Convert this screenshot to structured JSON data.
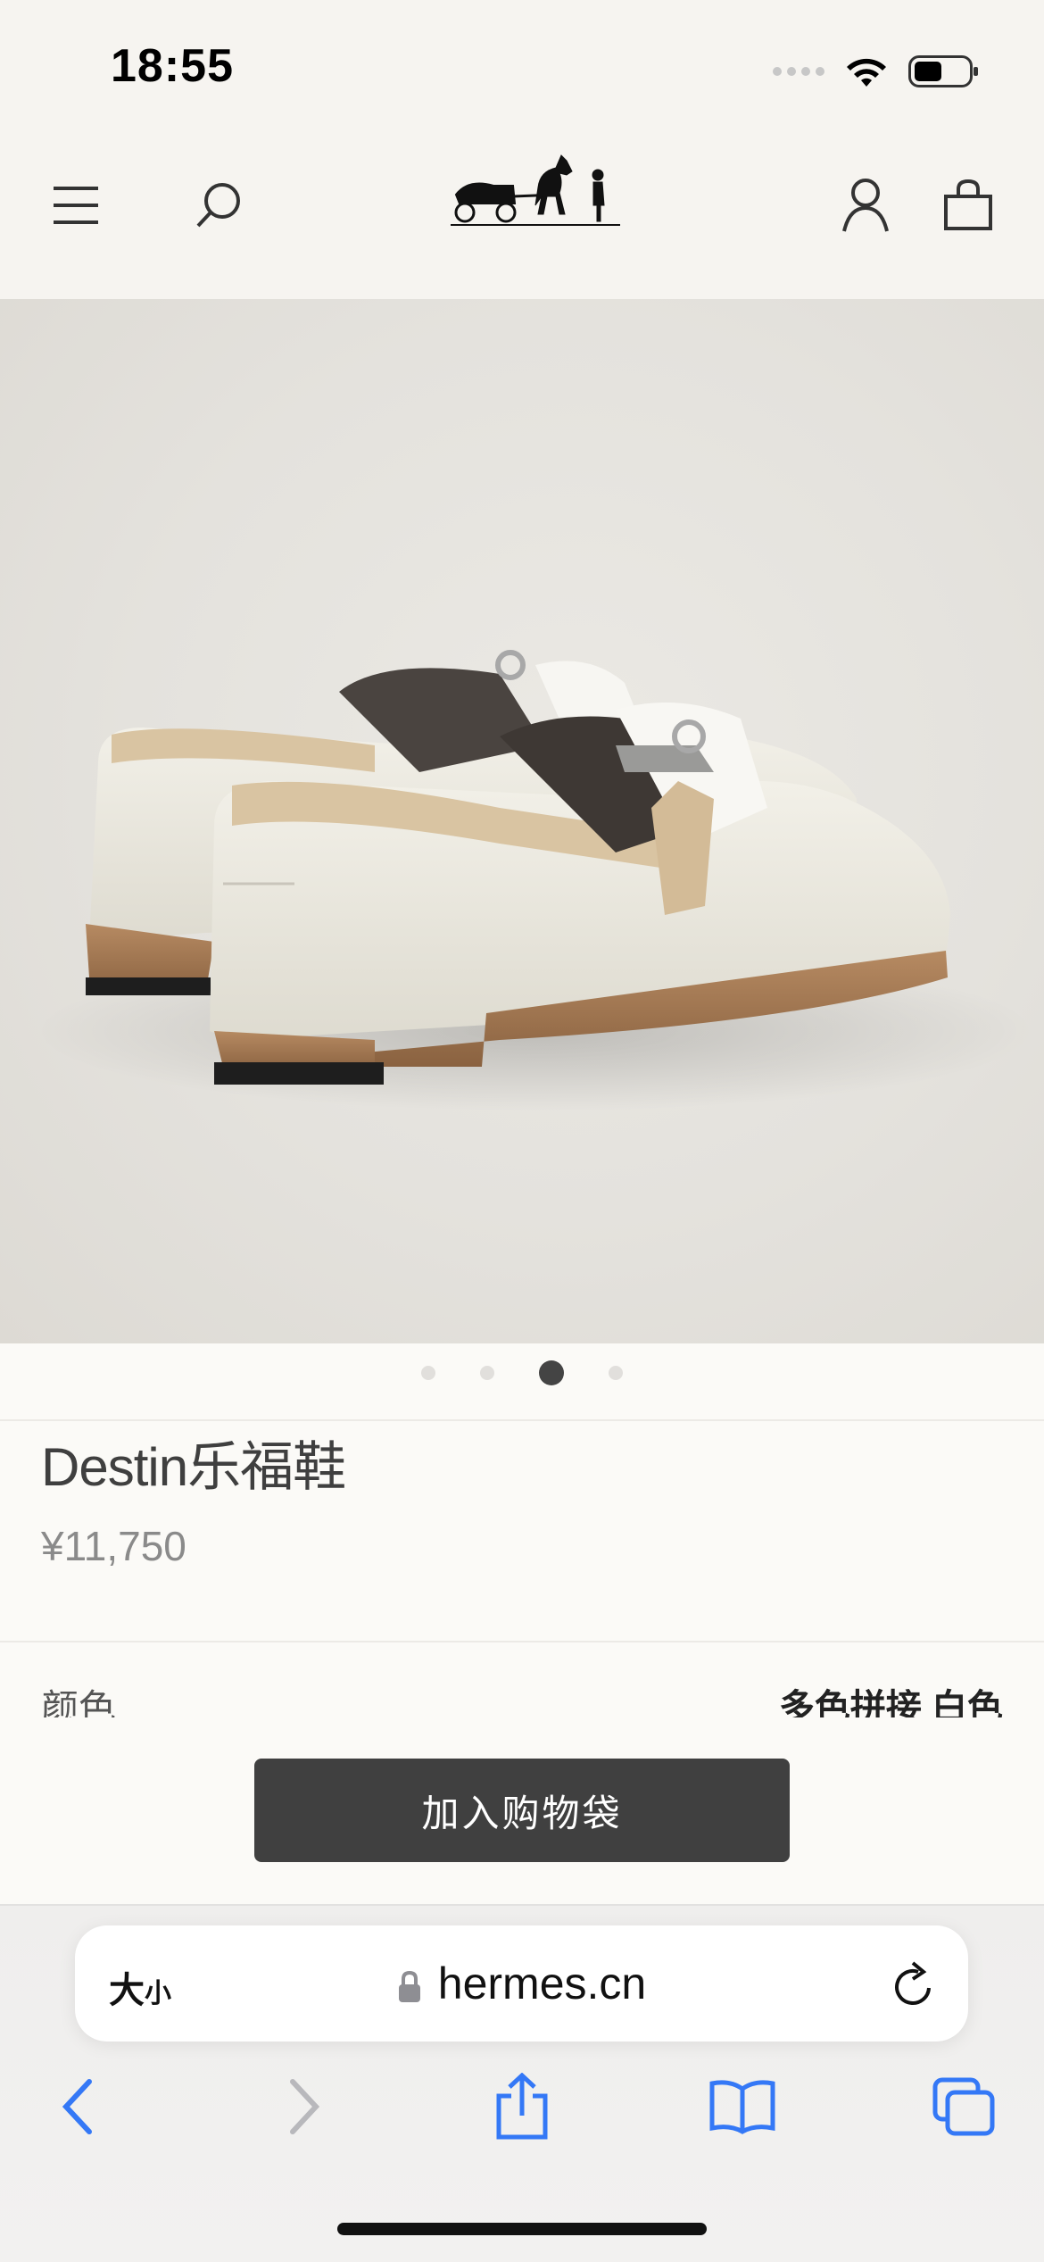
{
  "status_bar": {
    "time": "18:55"
  },
  "header": {
    "icons": [
      "menu-icon",
      "search-icon",
      "hermes-logo",
      "account-icon",
      "bag-icon"
    ]
  },
  "carousel": {
    "total": 4,
    "active_index": 2
  },
  "product": {
    "title": "Destin乐福鞋",
    "price": "¥11,750",
    "color_label": "颜色",
    "color_value": "多色拼接 白色",
    "add_to_bag": "加入购物袋"
  },
  "browser": {
    "text_size_label": "大",
    "text_size_small": "小",
    "domain": "hermes.cn",
    "toolbar_icons": [
      "back-icon",
      "forward-icon",
      "share-icon",
      "bookmarks-icon",
      "tabs-icon"
    ]
  },
  "colors": {
    "button": "#404040",
    "link_blue": "#3478f6",
    "background": "#f6f4f0"
  }
}
